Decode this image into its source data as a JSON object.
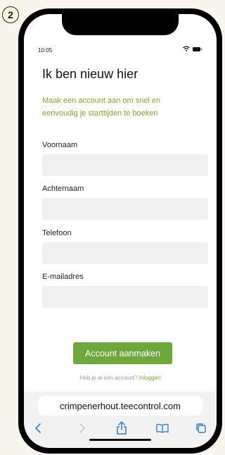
{
  "step": "2",
  "status_bar": {
    "time": "10:05"
  },
  "form": {
    "title": "Ik ben nieuw hier",
    "subtitle": "Maak een account aan om snel en eenvoudig je starttijden te boeken",
    "fields": [
      {
        "label": "Voornaam",
        "value": ""
      },
      {
        "label": "Achternaam",
        "value": ""
      },
      {
        "label": "Telefoon",
        "value": ""
      },
      {
        "label": "E-mailadres",
        "value": ""
      }
    ],
    "submit_label": "Account aanmaken",
    "login_prompt": "Heb je al een account?",
    "login_link": "Inloggen"
  },
  "browser": {
    "url": "crimpenerhout.teecontrol.com",
    "toolbar_icons": [
      "back-icon",
      "forward-icon",
      "share-icon",
      "bookmarks-icon",
      "tabs-icon"
    ]
  },
  "colors": {
    "accent": "#6fa83a",
    "subtitle": "#7aac2f",
    "input_bg": "#f0f0f0",
    "page_bg": "#f7f5ec"
  }
}
